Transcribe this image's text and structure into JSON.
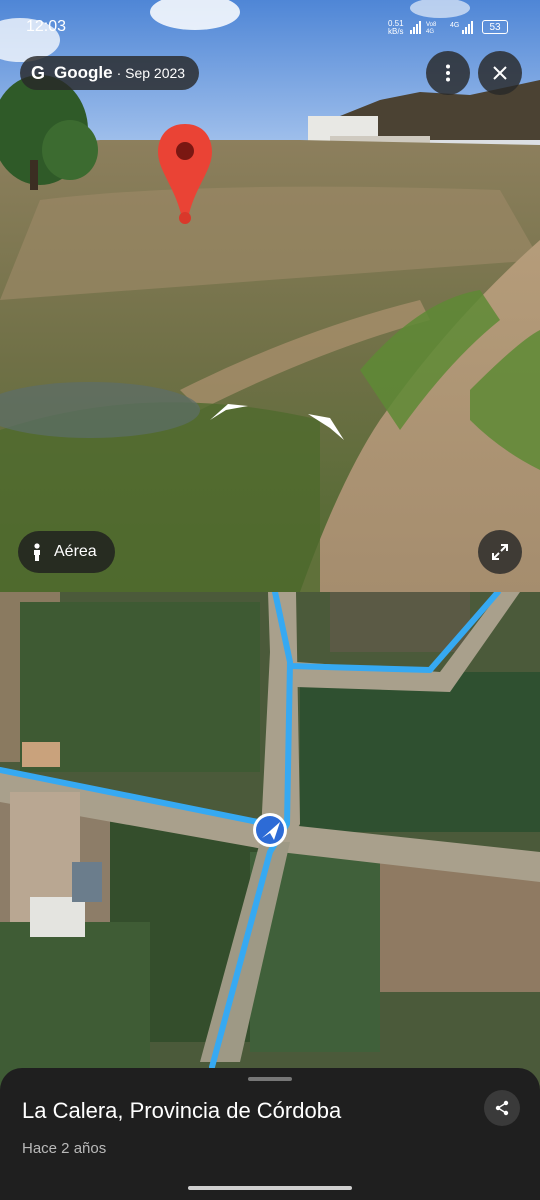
{
  "status_bar": {
    "time": "12:03",
    "speed_value": "0.51",
    "speed_unit": "kB/s",
    "network_1": "Vo8",
    "network_2": "4G",
    "battery": "53"
  },
  "streetview": {
    "source_brand": "Google",
    "capture_date": "· Sep 2023",
    "pin_icon": "red-location-pin-icon",
    "menu_icon": "vertical-dots-icon",
    "close_icon": "close-icon",
    "view_toggle_label": "Aérea",
    "expand_icon": "expand-icon"
  },
  "map": {
    "route_color": "#36a9f2",
    "position_marker": "navigation-arrow-icon"
  },
  "bottom_sheet": {
    "place_name": "La Calera, Provincia de Córdoba",
    "time_ago": "Hace 2 años",
    "share_icon": "share-icon"
  }
}
